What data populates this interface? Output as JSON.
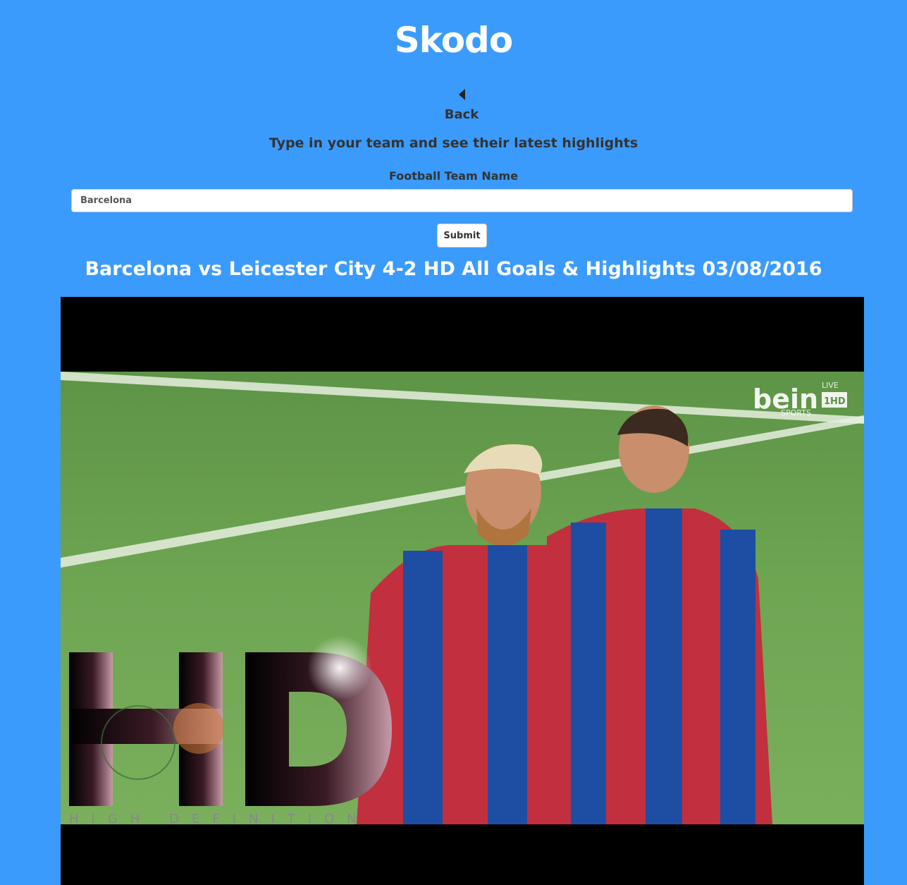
{
  "header": {
    "brand": "Skodo"
  },
  "nav": {
    "back_label": "Back",
    "back_icon": "chevron-left-icon"
  },
  "form": {
    "tagline": "Type in your team and see their latest highlights",
    "field_label": "Football Team Name",
    "team_value": "Barcelona",
    "submit_label": "Submit"
  },
  "video": {
    "title": "Barcelona vs Leicester City 4-2 HD All Goals & Highlights 03/08/2016",
    "broadcaster_logo": "bein",
    "broadcaster_sub": "SPORTS",
    "live_badge": "LIVE",
    "hd_badge": "1HD",
    "watermark_big": "HD",
    "watermark_small": "HIGH DEFINITION"
  },
  "colors": {
    "background": "#3a9bfd",
    "title_text": "#ffffff",
    "body_text": "#333333",
    "player_bg": "#000000"
  }
}
